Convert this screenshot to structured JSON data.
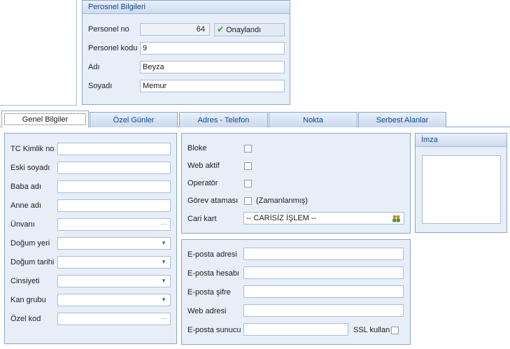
{
  "personnel_info": {
    "title": "Perosnel Bilgileri",
    "personnel_no_label": "Personel no",
    "personnel_no_value": "64",
    "approved_label": "Onaylandı",
    "personnel_code_label": "Personel kodu",
    "personnel_code_value": "9",
    "name_label": "Adı",
    "name_value": "Beyza",
    "surname_label": "Soyadı",
    "surname_value": "Memur"
  },
  "tabs": [
    {
      "label": "Genel Bilgiler",
      "active": true
    },
    {
      "label": "Özel Günler",
      "active": false
    },
    {
      "label": "Adres - Telefon",
      "active": false
    },
    {
      "label": "Nokta",
      "active": false
    },
    {
      "label": "Serbest Alanlar",
      "active": false
    }
  ],
  "general": {
    "tc_label": "TC Kimlik no",
    "prev_surname_label": "Eski soyadı",
    "father_label": "Baba adı",
    "mother_label": "Anne adı",
    "title_label": "Ünvanı",
    "birthplace_label": "Doğum yeri",
    "birthdate_label": "Doğum tarihi",
    "gender_label": "Cinsiyeti",
    "blood_label": "Kan grubu",
    "special_code_label": "Özel kod"
  },
  "flags": {
    "blocked_label": "Bloke",
    "web_active_label": "Web aktif",
    "operator_label": "Operatör",
    "task_label": "Görev ataması",
    "scheduled_label": "(Zamanlanmış)",
    "account_label": "Cari kart",
    "account_value": "-- CARİSİZ İŞLEM --"
  },
  "email": {
    "address_label": "E-posta adresi",
    "account_label": "E-posta hesabı",
    "password_label": "E-posta şifre",
    "web_label": "Web adresi",
    "server_label": "E-posta sunucu",
    "ssl_label": "SSL kullan"
  },
  "signature": {
    "title": "İmza"
  },
  "icons": {
    "dropdown": "chevron-down-icon",
    "ellipsis": "ellipsis-icon",
    "approved": "checkmark-icon",
    "lookup": "people-lookup-icon"
  },
  "colors": {
    "panel_bg": "#e7eef8",
    "border": "#8aa6c8",
    "title_text": "#15428b",
    "approved_tick": "#3c9a1e"
  }
}
